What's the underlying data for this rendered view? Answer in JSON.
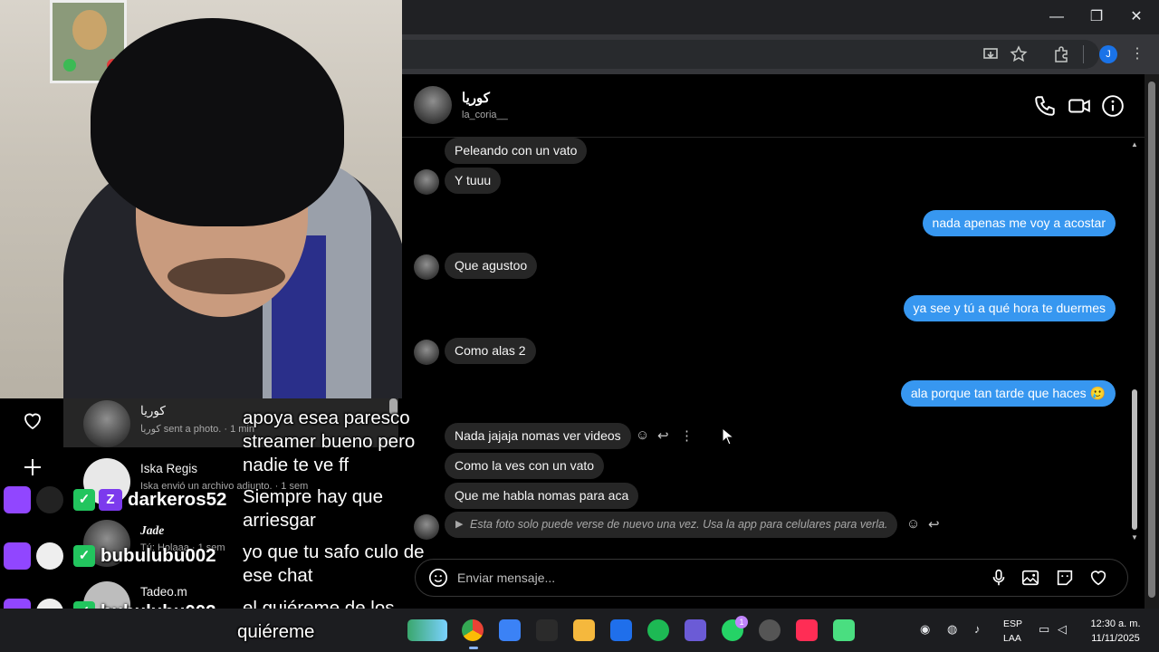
{
  "browser": {
    "window_controls": {
      "minimize": "—",
      "restore": "❐",
      "close": "✕"
    },
    "toolbar_icons": [
      "install-icon",
      "star-icon",
      "extensions-icon",
      "profile-icon",
      "menu-icon"
    ],
    "profile_initial": "J"
  },
  "chat": {
    "contact_name": "كوريا",
    "contact_username": "la_coria__",
    "messages": [
      {
        "side": "in",
        "text": "Peleando con un vato"
      },
      {
        "side": "in",
        "text": "Y tuuu"
      },
      {
        "side": "out",
        "text": "nada apenas me voy a acostar"
      },
      {
        "side": "in",
        "text": "Que agustoo"
      },
      {
        "side": "out",
        "text": "ya see y tú a qué hora te duermes"
      },
      {
        "side": "in",
        "text": "Como alas 2"
      },
      {
        "side": "out",
        "text": "ala porque tan tarde que haces 🥲"
      },
      {
        "side": "in",
        "text": "Nada jajaja nomas ver videos"
      },
      {
        "side": "in",
        "text": "Como la ves con un vato"
      },
      {
        "side": "in",
        "text": "Que me habla nomas para aca"
      },
      {
        "side": "in",
        "text": "Esta foto solo puede verse de nuevo una vez. Usa la app para celulares para verla."
      }
    ],
    "composer_placeholder": "Enviar mensaje..."
  },
  "inbox": {
    "items": [
      {
        "name": "كوريا",
        "subtitle": "كوريا sent a photo. · 1 min"
      },
      {
        "name": "Iska Regis",
        "subtitle": "Iska envió un archivo adjunto. · 1 sem"
      },
      {
        "name": "Jade",
        "subtitle": "Tú: Holaaa · 1 sem"
      },
      {
        "name": "Tadeo.m",
        "subtitle": ""
      }
    ]
  },
  "stream_chat": [
    {
      "user": "",
      "text": "apoya esea paresco streamer bueno pero nadie te ve ff"
    },
    {
      "user": "darkeros52",
      "text": "Siempre hay que arriesgar"
    },
    {
      "user": "bubulubu002",
      "text": "yo que tu safo culo de ese chat"
    },
    {
      "user": "bubulubu002",
      "text": "el quiéreme de los quiéreme"
    }
  ],
  "stream_chat_lines": {
    "l0a": "apoya esea paresco",
    "l0b": "streamer bueno pero",
    "l0c": "nadie te ve ff",
    "l1a": "Siempre hay que",
    "l1b": "arriesgar",
    "l2a": "yo que tu safo culo de",
    "l2b": "ese chat",
    "l3a": "el quiéreme de los",
    "l3b": "quiéreme"
  },
  "taskbar": {
    "lang_line1": "ESP",
    "lang_line2": "LAA",
    "time": "12:30 a. m.",
    "date": "11/11/2025",
    "whatsapp_badge": "1"
  },
  "colors": {
    "out_bubble": "#3797f0",
    "in_bubble": "#262626",
    "twitch": "#9146ff"
  }
}
